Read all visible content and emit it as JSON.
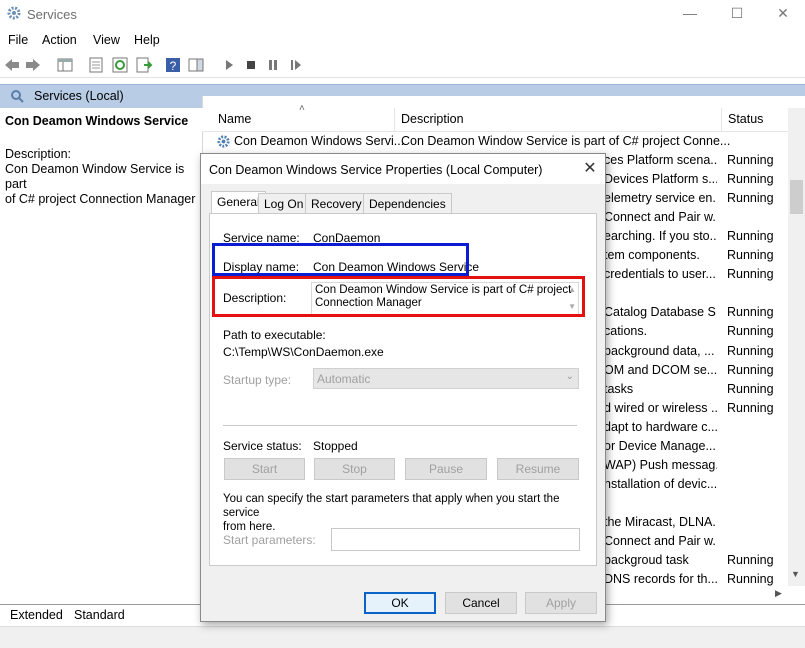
{
  "window": {
    "title": "Services",
    "controls": {
      "minimize": "—",
      "maximize": "☐",
      "close": "✕"
    }
  },
  "menu": [
    "File",
    "Action",
    "View",
    "Help"
  ],
  "header": {
    "label": "Services (Local)"
  },
  "left_pane": {
    "service_title": "Con Deamon Windows Service",
    "description_label": "Description:",
    "description_lines": [
      "Con Deamon Window Service is part",
      "of C# project Connection Manager"
    ]
  },
  "columns": {
    "name": "Name",
    "description": "Description",
    "status": "Status"
  },
  "first_row": {
    "name": "Con Deamon Windows Servi...",
    "description": "Con Deamon Window Service is part of C# project Conne..."
  },
  "rows": [
    {
      "desc": "ces Platform scena...",
      "status": "Running"
    },
    {
      "desc": "Devices Platform s...",
      "status": "Running"
    },
    {
      "desc": "elemetry service en...",
      "status": "Running"
    },
    {
      "desc": "Connect and Pair w...",
      "status": ""
    },
    {
      "desc": "earching. If you sto...",
      "status": "Running"
    },
    {
      "desc": "tem components.",
      "status": "Running"
    },
    {
      "desc": "credentials to user...",
      "status": "Running"
    },
    {
      "desc": "",
      "status": ""
    },
    {
      "desc": "Catalog Database S...",
      "status": "Running"
    },
    {
      "desc": "cations.",
      "status": "Running"
    },
    {
      "desc": "background data, ...",
      "status": "Running"
    },
    {
      "desc": "OM and DCOM se...",
      "status": "Running"
    },
    {
      "desc": "tasks",
      "status": "Running"
    },
    {
      "desc": "d wired or wireless ...",
      "status": "Running"
    },
    {
      "desc": "dapt to hardware c...",
      "status": ""
    },
    {
      "desc": "or Device Manage...",
      "status": ""
    },
    {
      "desc": "WAP) Push messag...",
      "status": ""
    },
    {
      "desc": "nstallation of devic...",
      "status": ""
    },
    {
      "desc": "",
      "status": ""
    },
    {
      "desc": "the Miracast, DLNA...",
      "status": ""
    },
    {
      "desc": "Connect and Pair w...",
      "status": ""
    },
    {
      "desc": "backgroud task",
      "status": "Running"
    },
    {
      "desc": "DNS records for th...",
      "status": "Running"
    }
  ],
  "bottom_tabs": {
    "extended": "Extended",
    "standard": "Standard"
  },
  "dialog": {
    "title": "Con Deamon Windows Service Properties (Local Computer)",
    "close": "✕",
    "tabs": [
      "General",
      "Log On",
      "Recovery",
      "Dependencies"
    ],
    "service_name_label": "Service name:",
    "service_name": "ConDaemon",
    "display_name_label": "Display name:",
    "display_name": "Con Deamon Windows Service",
    "description_label": "Description:",
    "description_lines": [
      "Con Deamon Window Service is part of C# project",
      "Connection Manager"
    ],
    "path_label": "Path to executable:",
    "path": "C:\\Temp\\WS\\ConDaemon.exe",
    "startup_type_label": "Startup type:",
    "startup_type": "Automatic",
    "service_status_label": "Service status:",
    "service_status": "Stopped",
    "buttons": {
      "start": "Start",
      "stop": "Stop",
      "pause": "Pause",
      "resume": "Resume"
    },
    "params_help_lines": [
      "You can specify the start parameters that apply when you start the service",
      "from here."
    ],
    "start_params_label": "Start parameters:",
    "start_params_value": "",
    "ok": "OK",
    "cancel": "Cancel",
    "apply": "Apply"
  },
  "colors": {
    "highlight_blue": "#0b1dd0",
    "highlight_red": "#e51111",
    "header_strip": "#b8cde5"
  }
}
